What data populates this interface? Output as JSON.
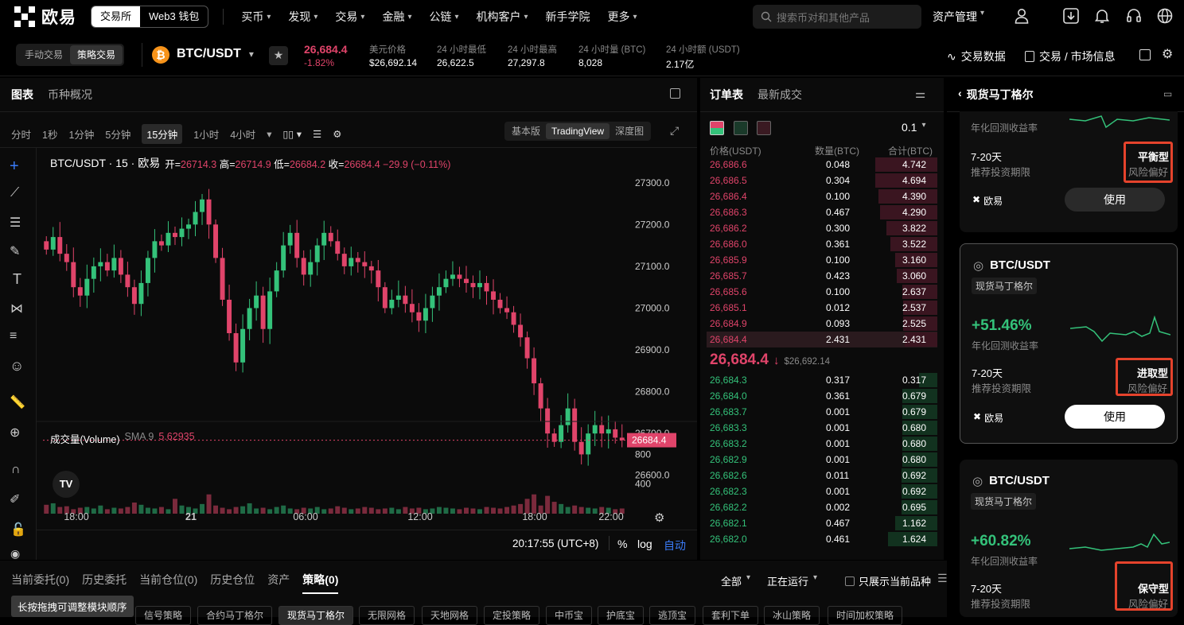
{
  "nav": {
    "brand": "欧易",
    "exchange": "交易所",
    "web3": "Web3 钱包",
    "items": [
      "买币",
      "发现",
      "交易",
      "金融",
      "公链",
      "机构客户",
      "新手学院",
      "更多"
    ],
    "search_placeholder": "搜索币对和其他产品",
    "asset": "资产管理"
  },
  "ticker": {
    "mode_manual": "手动交易",
    "mode_strategy": "策略交易",
    "pair": "BTC/USDT",
    "last": "26,684.4",
    "change": "-1.82%",
    "usd_label": "美元价格",
    "usd": "$26,692.14",
    "low_label": "24 小时最低",
    "low": "26,622.5",
    "high_label": "24 小时最高",
    "high": "27,297.8",
    "vol_btc_label": "24 小时量 (BTC)",
    "vol_btc": "8,028",
    "vol_usdt_label": "24 小时额 (USDT)",
    "vol_usdt": "2.17亿",
    "trade_data": "交易数据",
    "market_info": "交易 / 市场信息"
  },
  "chart": {
    "tab_chart": "图表",
    "tab_overview": "币种概况",
    "intervals": [
      "分时",
      "1秒",
      "1分钟",
      "5分钟",
      "15分钟",
      "1小时",
      "4小时"
    ],
    "views": [
      "基本版",
      "TradingView",
      "深度图"
    ],
    "legend_title": "BTC/USDT · 15 · 欧易",
    "o_label": "开=",
    "o": "26714.3",
    "h_label": "高=",
    "h": "26714.9",
    "l_label": "低=",
    "l": "26684.2",
    "c_label": "收=",
    "c": "26684.4",
    "chg": "−29.9 (−0.11%)",
    "price_ticks": [
      "27300.0",
      "27200.0",
      "27100.0",
      "27000.0",
      "26900.0",
      "26800.0",
      "26700.0",
      "26600.0"
    ],
    "last_price": "26684.4",
    "volume_label": "成交量(Volume)",
    "sma_label": "SMA 9",
    "sma_value": "5.62935",
    "vol_ticks": [
      "800",
      "400"
    ],
    "time_ticks": [
      "18:00",
      "21",
      "06:00",
      "12:00",
      "18:00",
      "22:00"
    ],
    "clock": "20:17:55 (UTC+8)",
    "pct": "%",
    "log": "log",
    "auto": "自动"
  },
  "chart_data": {
    "type": "candlestick",
    "title": "BTC/USDT · 15 · 欧易",
    "ylim": [
      26550,
      27330
    ],
    "x_ticks": [
      "18:00",
      "21",
      "06:00",
      "12:00",
      "18:00",
      "22:00"
    ],
    "close_series": [
      27140,
      27170,
      27130,
      27110,
      27050,
      27030,
      27070,
      27100,
      27110,
      27090,
      27120,
      27080,
      27050,
      27010,
      27060,
      27120,
      27160,
      27150,
      27180,
      27170,
      27190,
      27200,
      27230,
      27260,
      27200,
      27120,
      27020,
      26940,
      26870,
      26950,
      27000,
      27030,
      26950,
      27040,
      27090,
      27150,
      27180,
      27120,
      27080,
      27110,
      27150,
      27180,
      27160,
      27130,
      27100,
      27120,
      27110,
      27100,
      27090,
      27050,
      27000,
      27020,
      27030,
      27010,
      26990,
      26970,
      27000,
      27030,
      27050,
      27070,
      27080,
      27070,
      27060,
      27050,
      27060,
      27040,
      27020,
      27000,
      26990,
      26960,
      26930,
      26880,
      26820,
      26760,
      26700,
      26680,
      26720,
      26760,
      26680,
      26650,
      26700,
      26720,
      26700,
      26710,
      26690,
      26684
    ],
    "volume": [
      120,
      140,
      90,
      100,
      60,
      80,
      90,
      70,
      110,
      60,
      80,
      70,
      90,
      150,
      120,
      80,
      70,
      90,
      60,
      200,
      110,
      90,
      70,
      130,
      260,
      110,
      80,
      60,
      90,
      100,
      140,
      70,
      80,
      60,
      90,
      110,
      70,
      60,
      80,
      70,
      90,
      60,
      70,
      100,
      80,
      60,
      70,
      90,
      80,
      60,
      70,
      80,
      60,
      90,
      70,
      80,
      60,
      70,
      90,
      80,
      70,
      60,
      80,
      70,
      60,
      90,
      80,
      70,
      90,
      110,
      130,
      200,
      260,
      110,
      240,
      160,
      130,
      90,
      110,
      90,
      80,
      70,
      90,
      80,
      60,
      70
    ]
  },
  "orderbook": {
    "tab_book": "订单表",
    "tab_trades": "最新成交",
    "precision": "0.1",
    "col_price": "价格(USDT)",
    "col_qty": "数量(BTC)",
    "col_total": "合计(BTC)",
    "asks": [
      [
        "26,686.6",
        "0.048",
        "4.742"
      ],
      [
        "26,686.5",
        "0.304",
        "4.694"
      ],
      [
        "26,686.4",
        "0.100",
        "4.390"
      ],
      [
        "26,686.3",
        "0.467",
        "4.290"
      ],
      [
        "26,686.2",
        "0.300",
        "3.822"
      ],
      [
        "26,686.0",
        "0.361",
        "3.522"
      ],
      [
        "26,685.9",
        "0.100",
        "3.160"
      ],
      [
        "26,685.7",
        "0.423",
        "3.060"
      ],
      [
        "26,685.6",
        "0.100",
        "2.637"
      ],
      [
        "26,685.1",
        "0.012",
        "2.537"
      ],
      [
        "26,684.9",
        "0.093",
        "2.525"
      ],
      [
        "26,684.4",
        "2.431",
        "2.431"
      ]
    ],
    "mid_price": "26,684.4",
    "mid_usd": "$26,692.14",
    "bids": [
      [
        "26,684.3",
        "0.317",
        "0.317"
      ],
      [
        "26,684.0",
        "0.361",
        "0.679"
      ],
      [
        "26,683.7",
        "0.001",
        "0.679"
      ],
      [
        "26,683.3",
        "0.001",
        "0.680"
      ],
      [
        "26,683.2",
        "0.001",
        "0.680"
      ],
      [
        "26,682.9",
        "0.001",
        "0.680"
      ],
      [
        "26,682.6",
        "0.011",
        "0.692"
      ],
      [
        "26,682.3",
        "0.001",
        "0.692"
      ],
      [
        "26,682.2",
        "0.002",
        "0.695"
      ],
      [
        "26,682.1",
        "0.467",
        "1.162"
      ],
      [
        "26,682.0",
        "0.461",
        "1.624"
      ]
    ],
    "ask_depth": [
      0.9,
      0.9,
      0.85,
      0.83,
      0.74,
      0.68,
      0.61,
      0.59,
      0.51,
      0.49,
      0.49,
      0.47
    ],
    "bid_depth": [
      0.27,
      0.51,
      0.51,
      0.51,
      0.51,
      0.51,
      0.52,
      0.52,
      0.52,
      0.61,
      0.71
    ]
  },
  "strategy": {
    "title": "现货马丁格尔",
    "top_card": {
      "return_label": "年化回测收益率",
      "period": "7-20天",
      "period_label": "推荐投资期限",
      "risk": "平衡型",
      "risk_label": "风险偏好",
      "provider": "欧易",
      "use": "使用"
    },
    "cards": [
      {
        "pair": "BTC/USDT",
        "tag": "现货马丁格尔",
        "return": "+51.46%",
        "return_label": "年化回测收益率",
        "period": "7-20天",
        "period_label": "推荐投资期限",
        "risk": "进取型",
        "risk_label": "风险偏好",
        "provider": "欧易",
        "use": "使用"
      },
      {
        "pair": "BTC/USDT",
        "tag": "现货马丁格尔",
        "return": "+60.82%",
        "return_label": "年化回测收益率",
        "period": "7-20天",
        "period_label": "推荐投资期限",
        "risk": "保守型",
        "risk_label": "风险偏好"
      }
    ]
  },
  "bottom": {
    "tabs": [
      "当前委托(0)",
      "历史委托",
      "当前仓位(0)",
      "历史仓位",
      "资产",
      "策略(0)"
    ],
    "filter_all": "全部",
    "filter_running": "正在运行",
    "only_current": "只展示当前品种",
    "tooltip": "长按拖拽可调整模块顺序",
    "strategy_tabs": [
      "信号策略",
      "合约马丁格尔",
      "现货马丁格尔",
      "无限网格",
      "天地网格",
      "定投策略",
      "中币宝",
      "护底宝",
      "逃顶宝",
      "套利下单",
      "冰山策略",
      "时间加权策略"
    ]
  }
}
